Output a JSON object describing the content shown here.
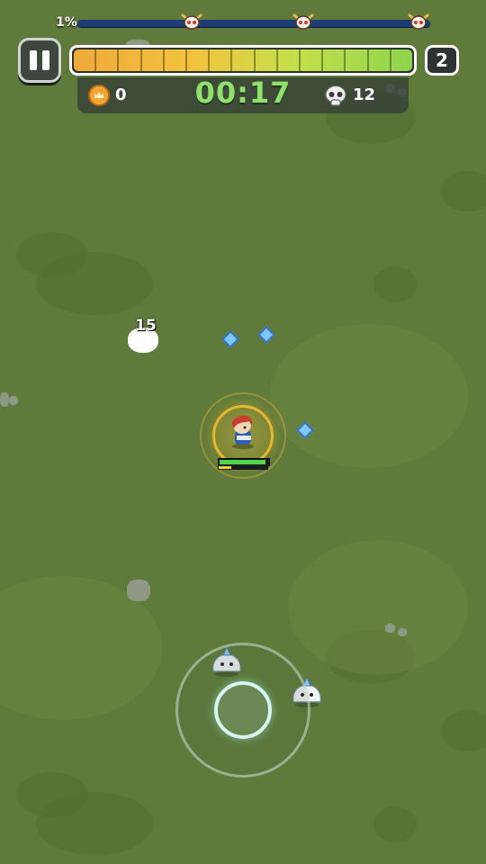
{
  "hud": {
    "stage_progress_percent": "1%",
    "stage_progress_value": 0.01,
    "boss_markers": [
      "boss-skull-icon",
      "boss-skull-icon",
      "boss-skull-icon"
    ],
    "xp_segments": 15,
    "xp_fill_fraction": 0.98,
    "level": "2",
    "coins": "0",
    "timer": "00:17",
    "kills": "12"
  },
  "world": {
    "damage_number": "15",
    "gems": [
      "xp-gem-icon",
      "xp-gem-icon",
      "xp-gem-icon"
    ],
    "hero": {
      "hp_fraction": 0.95,
      "xp_fraction": 0.25
    }
  },
  "colors": {
    "grass": "#5f7a3a",
    "timer": "#8fe06c",
    "progress_track": "#1f3b74",
    "gem": "#7fc7f4",
    "aura": "#ffc432"
  }
}
